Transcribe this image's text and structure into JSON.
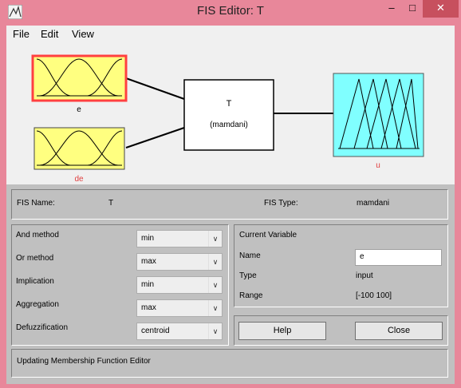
{
  "window": {
    "title": "FIS Editor: T"
  },
  "menu": {
    "file": "File",
    "edit": "Edit",
    "view": "View"
  },
  "diagram": {
    "inputs": [
      {
        "name": "e",
        "selected": true
      },
      {
        "name": "de",
        "selected": false
      }
    ],
    "system_name": "T",
    "system_type": "(mamdani)",
    "output": {
      "name": "u"
    },
    "colors": {
      "input_fill": "#ffff80",
      "output_fill": "#80ffff",
      "selected_border": "#ff4040",
      "label_red": "#e04040"
    }
  },
  "fis": {
    "name_label": "FIS Name:",
    "name_value": "T",
    "type_label": "FIS Type:",
    "type_value": "mamdani"
  },
  "methods": [
    {
      "label": "And method",
      "value": "min"
    },
    {
      "label": "Or method",
      "value": "max"
    },
    {
      "label": "Implication",
      "value": "min"
    },
    {
      "label": "Aggregation",
      "value": "max"
    },
    {
      "label": "Defuzzification",
      "value": "centroid"
    }
  ],
  "current_variable": {
    "heading": "Current Variable",
    "name_label": "Name",
    "name_value": "e",
    "type_label": "Type",
    "type_value": "input",
    "range_label": "Range",
    "range_value": "[-100 100]"
  },
  "buttons": {
    "help": "Help",
    "close": "Close"
  },
  "status": "Updating Membership Function Editor"
}
